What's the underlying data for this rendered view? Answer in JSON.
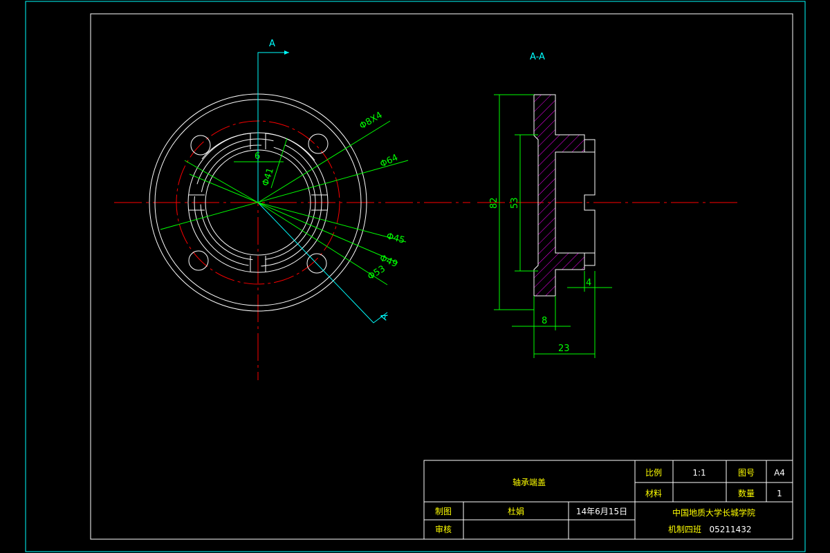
{
  "section_marker": "A",
  "section_title": "A-A",
  "front_view": {
    "dims": {
      "hole": "Φ8X4",
      "pcd": "Φ64",
      "slot_width": "6",
      "d41": "Φ41",
      "d45": "Φ45",
      "d49": "Φ49",
      "d53": "Φ53"
    }
  },
  "section_view": {
    "dims": {
      "d82": "82",
      "d53": "53",
      "w4": "4",
      "w8": "8",
      "w23": "23"
    }
  },
  "title_block": {
    "part_name": "轴承端盖",
    "scale_label": "比例",
    "scale_value": "1:1",
    "drawing_no_label": "图号",
    "drawing_no_value": "A4",
    "material_label": "材料",
    "material_value": "",
    "quantity_label": "数量",
    "quantity_value": "1",
    "drawn_label": "制图",
    "drawn_by": "杜娟",
    "date": "14年6月15日",
    "checked_label": "审核",
    "checked_by": "",
    "school": "中国地质大学长城学院",
    "class_label": "机制四班",
    "class_no": "05211432"
  },
  "colors": {
    "frame": "#00ffff",
    "outline": "#ffffff",
    "center": "#ff0000",
    "dimension": "#00ff00",
    "hatch": "#ff00ff",
    "title_text": "#ffff00"
  }
}
